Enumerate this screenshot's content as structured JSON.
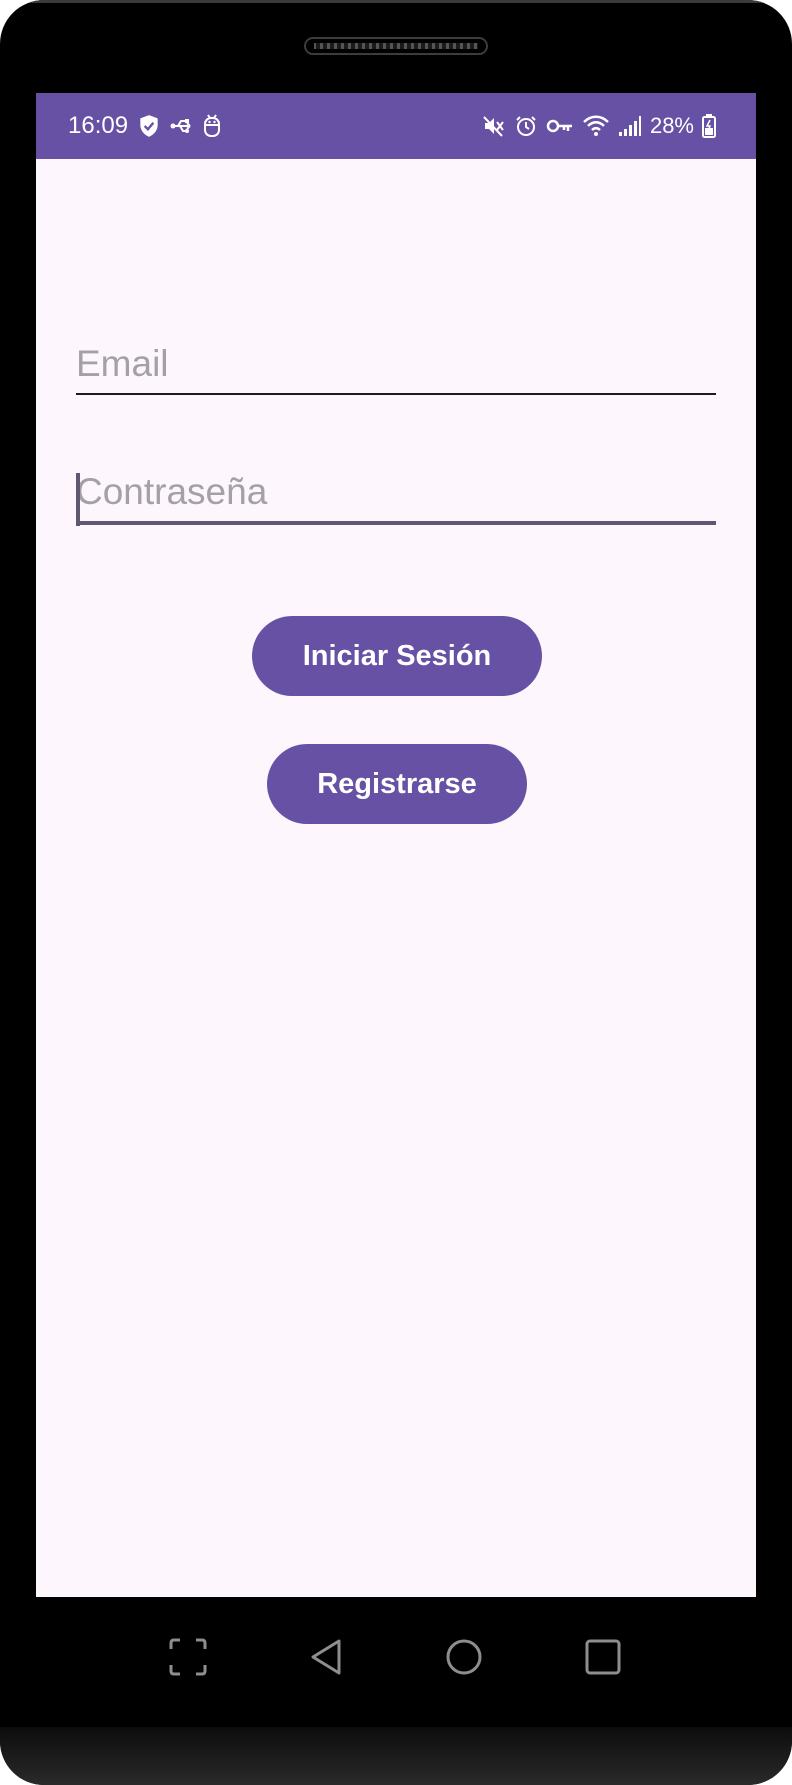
{
  "status_bar": {
    "time": "16:09",
    "battery": "28%",
    "left_icons": [
      "shield-check-icon",
      "usb-icon",
      "bug-icon"
    ],
    "right_icons": [
      "mute-icon",
      "alarm-icon",
      "vpn-key-icon",
      "wifi-icon",
      "signal-icon",
      "battery-icon"
    ]
  },
  "form": {
    "email": {
      "placeholder": "Email",
      "value": ""
    },
    "password": {
      "placeholder": "Contraseña",
      "value": ""
    }
  },
  "buttons": {
    "login": "Iniciar Sesión",
    "register": "Registrarse"
  },
  "nav": {
    "icons": [
      "screenshot-icon",
      "back-icon",
      "home-icon",
      "recents-icon"
    ]
  },
  "colors": {
    "primary": "#6751a4",
    "background": "#fdf7fd",
    "placeholder": "#a3a0a8"
  }
}
